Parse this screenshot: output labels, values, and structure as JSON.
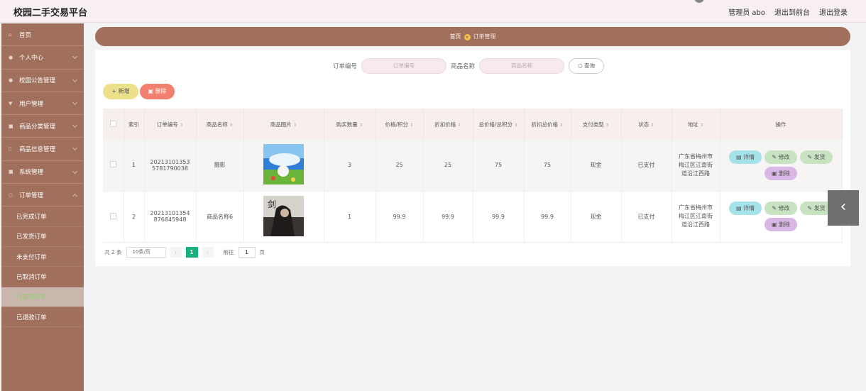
{
  "app": {
    "title": "校园二手交易平台"
  },
  "header": {
    "admin": "管理员 abo",
    "front": "退出到前台",
    "logout": "退出登录"
  },
  "sidebar": {
    "items": [
      {
        "icon": "home-icon",
        "label": "首页",
        "chevron": false
      },
      {
        "icon": "user-icon",
        "label": "个人中心",
        "chevron": true
      },
      {
        "icon": "notice-icon",
        "label": "校园公告管理",
        "chevron": true
      },
      {
        "icon": "users-icon",
        "label": "用户管理",
        "chevron": true
      },
      {
        "icon": "category-icon",
        "label": "商品分类管理",
        "chevron": true
      },
      {
        "icon": "goods-icon",
        "label": "商品信息管理",
        "chevron": true
      },
      {
        "icon": "system-icon",
        "label": "系统管理",
        "chevron": true
      },
      {
        "icon": "order-icon",
        "label": "订单管理",
        "chevron": true
      }
    ],
    "subitems": [
      "已完成订单",
      "已发货订单",
      "未支付订单",
      "已取消订单",
      "已支付订单",
      "已退款订单"
    ],
    "active_sub": 4
  },
  "breadcrumb": {
    "home": "首页",
    "current": "订单管理"
  },
  "search": {
    "order_label": "订单编号",
    "order_placeholder": "订单编号",
    "name_label": "商品名称",
    "name_placeholder": "商品名称",
    "button": "查询"
  },
  "actions": {
    "add": "新增",
    "delete": "删除"
  },
  "table": {
    "headers": [
      "索引",
      "订单编号",
      "商品名称",
      "商品图片",
      "购买数量",
      "价格/积分",
      "折扣价格",
      "总价格/总积分",
      "折扣总价格",
      "支付类型",
      "状态",
      "地址",
      "操作"
    ],
    "rows": [
      {
        "index": "1",
        "order_no": "202131013535781790038",
        "name": "摄影",
        "image": "landscape-photo",
        "qty": "3",
        "price": "25",
        "discount": "25",
        "total": "75",
        "discount_total": "75",
        "pay_type": "现金",
        "status": "已支付",
        "address": "广东省梅州市梅江区江南街道沿江西路"
      },
      {
        "index": "2",
        "order_no": "20213101354876845948",
        "name": "商品名称6",
        "image": "book-cover",
        "qty": "1",
        "price": "99.9",
        "discount": "99.9",
        "total": "99.9",
        "discount_total": "99.9",
        "pay_type": "现金",
        "status": "已支付",
        "address": "广东省梅州市梅江区江南街道沿江西路"
      }
    ],
    "ops": {
      "detail": "详情",
      "edit": "修改",
      "ship": "发货",
      "remove": "删除"
    }
  },
  "pager": {
    "total": "共 2 条",
    "size": "10条/页",
    "current": "1",
    "goto": "前往",
    "goto_value": "1",
    "unit": "页"
  },
  "float": {
    "arrow": "‹"
  }
}
